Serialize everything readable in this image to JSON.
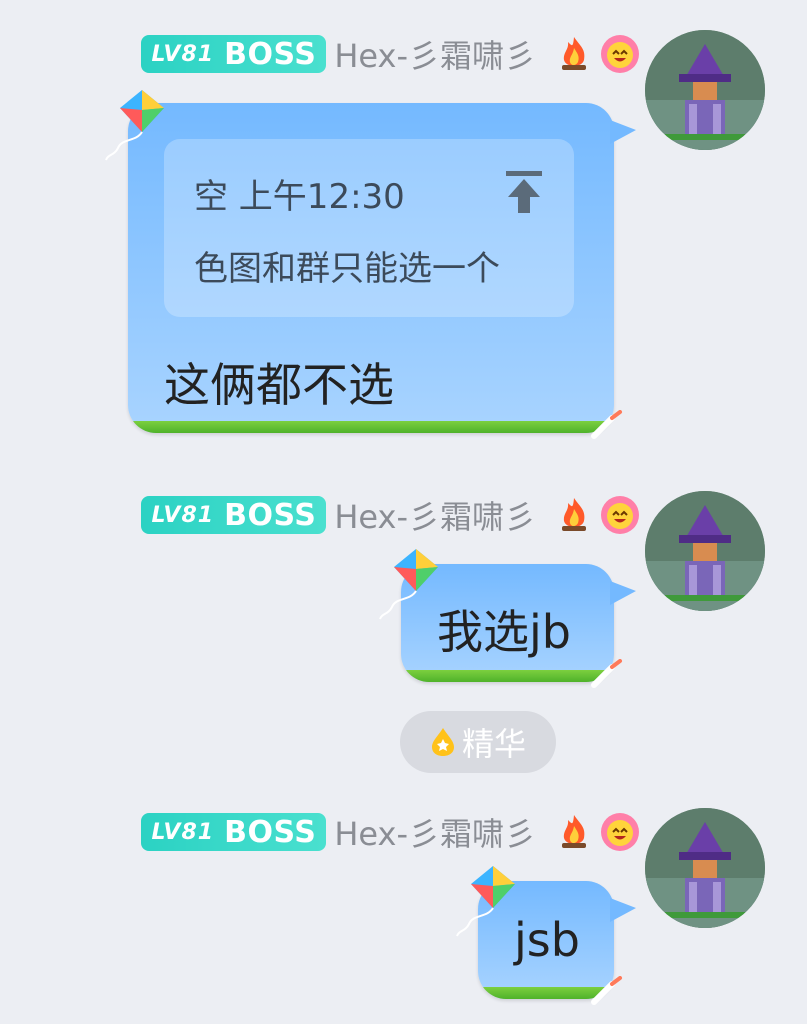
{
  "messages": [
    {
      "badge": {
        "level": "LV81",
        "title": "BOSS"
      },
      "nickname": "Hex-彡霜啸彡",
      "quote": {
        "meta": "空 上午12:30",
        "text": "色图和群只能选一个"
      },
      "text": "这俩都不选"
    },
    {
      "badge": {
        "level": "LV81",
        "title": "BOSS"
      },
      "nickname": "Hex-彡霜啸彡",
      "text": "我选jb"
    },
    {
      "badge": {
        "level": "LV81",
        "title": "BOSS"
      },
      "nickname": "Hex-彡霜啸彡",
      "text": "jsb"
    }
  ],
  "essence_tag": {
    "label": "精华",
    "icon": "essence-drop-icon"
  },
  "colors": {
    "bubble_top": "#74b9ff",
    "bubble_bottom": "#a9d4ff",
    "badge": "#2bd2c3",
    "grass": "#4fb22a"
  }
}
